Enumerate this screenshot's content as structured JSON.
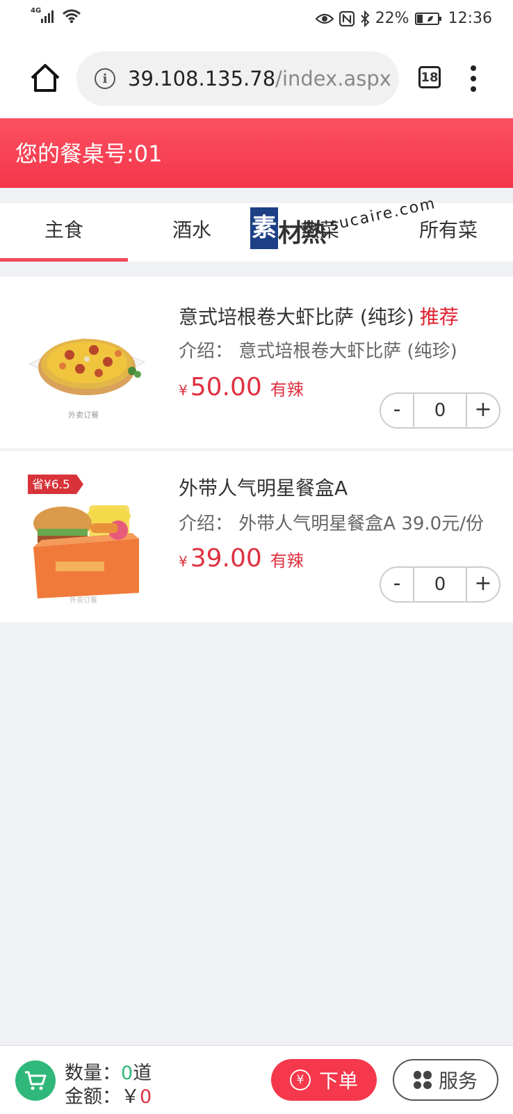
{
  "status_bar": {
    "network": "4G",
    "battery": "22%",
    "time": "12:36"
  },
  "browser": {
    "url_host": "39.108.135.78",
    "url_path": "/index.aspх",
    "tab_count": "18"
  },
  "header": {
    "table_label": "您的餐桌号:01"
  },
  "tabs": [
    {
      "label": "主食",
      "active": true
    },
    {
      "label": "酒水",
      "active": false
    },
    {
      "label": "热菜",
      "active": false
    },
    {
      "label": "所有菜",
      "active": false
    }
  ],
  "watermark": {
    "block": "素",
    "text": "材熱",
    "url": "sucaire.com"
  },
  "dishes": [
    {
      "name": "意式培根卷大虾比萨 (纯珍)",
      "badge": "推荐",
      "desc": "介绍： 意式培根卷大虾比萨 (纯珍)",
      "currency": "¥",
      "price": "50.00",
      "tag": "有辣",
      "qty": "0",
      "img_caption": "外卖订餐"
    },
    {
      "name": "外带人气明星餐盒A",
      "badge": "",
      "desc": "介绍： 外带人气明星餐盒A 39.0元/份",
      "currency": "¥",
      "price": "39.00",
      "tag": "有辣",
      "qty": "0",
      "img_caption": "外卖订餐",
      "promo": "省¥6.5"
    }
  ],
  "stepper": {
    "minus": "-",
    "plus": "+"
  },
  "footer": {
    "qty_label": "数量：",
    "qty_value": "0",
    "qty_unit": "道",
    "amount_label": "金额：",
    "amount_currency": "￥",
    "amount_value": "0",
    "order_label": "下单",
    "order_icon_glyph": "¥",
    "service_label": "服务"
  },
  "colors": {
    "primary_red": "#f4364b",
    "accent_green": "#2fb87a",
    "watermark_blue": "#1c3f86"
  }
}
